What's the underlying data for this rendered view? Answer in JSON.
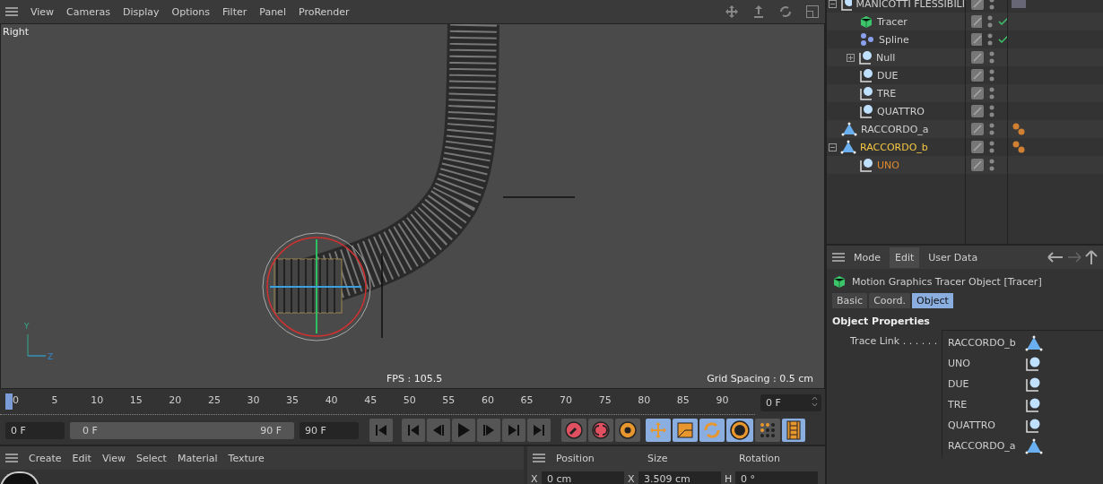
{
  "viewport": {
    "menu": [
      "View",
      "Cameras",
      "Display",
      "Options",
      "Filter",
      "Panel",
      "ProRender"
    ],
    "view_label": "Right",
    "axis_labels": [
      "Y",
      "Z"
    ],
    "fps": "FPS : 105.5",
    "grid_spacing": "Grid Spacing : 0.5 cm"
  },
  "timeline": {
    "ticks": [
      "0",
      "5",
      "10",
      "15",
      "20",
      "25",
      "30",
      "35",
      "40",
      "45",
      "50",
      "55",
      "60",
      "65",
      "70",
      "75",
      "80",
      "85",
      "90"
    ],
    "current_frame": "0 F",
    "start": "0 F",
    "range": {
      "level": 1,
      "start": "0 F",
      "end": "90 F"
    },
    "end": "90 F"
  },
  "transport": [
    {
      "kind": "goto-start"
    },
    {
      "kind": "prev-key"
    },
    {
      "kind": "prev-frame"
    },
    {
      "kind": "play"
    },
    {
      "kind": "next-frame"
    },
    {
      "kind": "next-key"
    },
    {
      "kind": "goto-end"
    }
  ],
  "tools": [
    {
      "kind": "record",
      "active": false
    },
    {
      "kind": "autokey",
      "active": false
    },
    {
      "kind": "key-settings",
      "active": false
    },
    {
      "kind": "move",
      "active": true
    },
    {
      "kind": "scale",
      "active": true
    },
    {
      "kind": "rotate",
      "active": true
    },
    {
      "kind": "param",
      "active": true
    },
    {
      "kind": "points",
      "active": false
    },
    {
      "kind": "film",
      "active": true
    }
  ],
  "material_menu": [
    "Create",
    "Edit",
    "View",
    "Select",
    "Material",
    "Texture"
  ],
  "coordinates": {
    "headers": [
      "Position",
      "Size",
      "Rotation"
    ],
    "fields": [
      {
        "axis": "X",
        "value": "0 cm"
      },
      {
        "axis": "X",
        "value": "3.509 cm"
      },
      {
        "axis": "H",
        "value": "0 °"
      }
    ]
  },
  "objects": [
    {
      "name": "MANICOTTI FLESSIBILI",
      "kind": "null",
      "selected": false,
      "expanded": true,
      "checked": false,
      "material_tag": true,
      "children": [
        {
          "name": "Tracer",
          "kind": "tracer",
          "selected": false,
          "checked": true
        },
        {
          "name": "Spline",
          "kind": "spline",
          "selected": false,
          "checked": true
        },
        {
          "name": "Null",
          "kind": "null",
          "selected": false,
          "checked": false,
          "expanded": false
        },
        {
          "name": "DUE",
          "kind": "null",
          "selected": false,
          "checked": false
        },
        {
          "name": "TRE",
          "kind": "null",
          "selected": false,
          "checked": false
        },
        {
          "name": "QUATTRO",
          "kind": "null",
          "selected": false,
          "checked": false
        }
      ]
    },
    {
      "name": "RACCORDO_a",
      "kind": "mesh",
      "selected": false,
      "checked": false,
      "phong_tag": true
    },
    {
      "name": "RACCORDO_b",
      "kind": "mesh",
      "selected": true,
      "expanded": true,
      "checked": false,
      "phong_tag": true,
      "children": [
        {
          "name": "UNO",
          "kind": "null",
          "selected": false,
          "checked": false
        }
      ]
    }
  ],
  "attributes": {
    "tabs": [
      {
        "label": "Mode",
        "selected": false
      },
      {
        "label": "Edit",
        "selected": true
      },
      {
        "label": "User Data",
        "selected": false
      }
    ],
    "title": "Motion Graphics Tracer Object [Tracer]",
    "subtabs": [
      {
        "label": "Basic",
        "selected": false
      },
      {
        "label": "Coord.",
        "selected": false
      },
      {
        "label": "Object",
        "selected": true
      }
    ],
    "section": "Object Properties",
    "field_label": "Trace Link . . . . . .",
    "links": [
      {
        "name": "RACCORDO_b",
        "kind": "mesh"
      },
      {
        "name": "UNO",
        "kind": "null"
      },
      {
        "name": "DUE",
        "kind": "null"
      },
      {
        "name": "TRE",
        "kind": "null"
      },
      {
        "name": "QUATTRO",
        "kind": "null"
      },
      {
        "name": "RACCORDO_a",
        "kind": "mesh"
      }
    ]
  }
}
